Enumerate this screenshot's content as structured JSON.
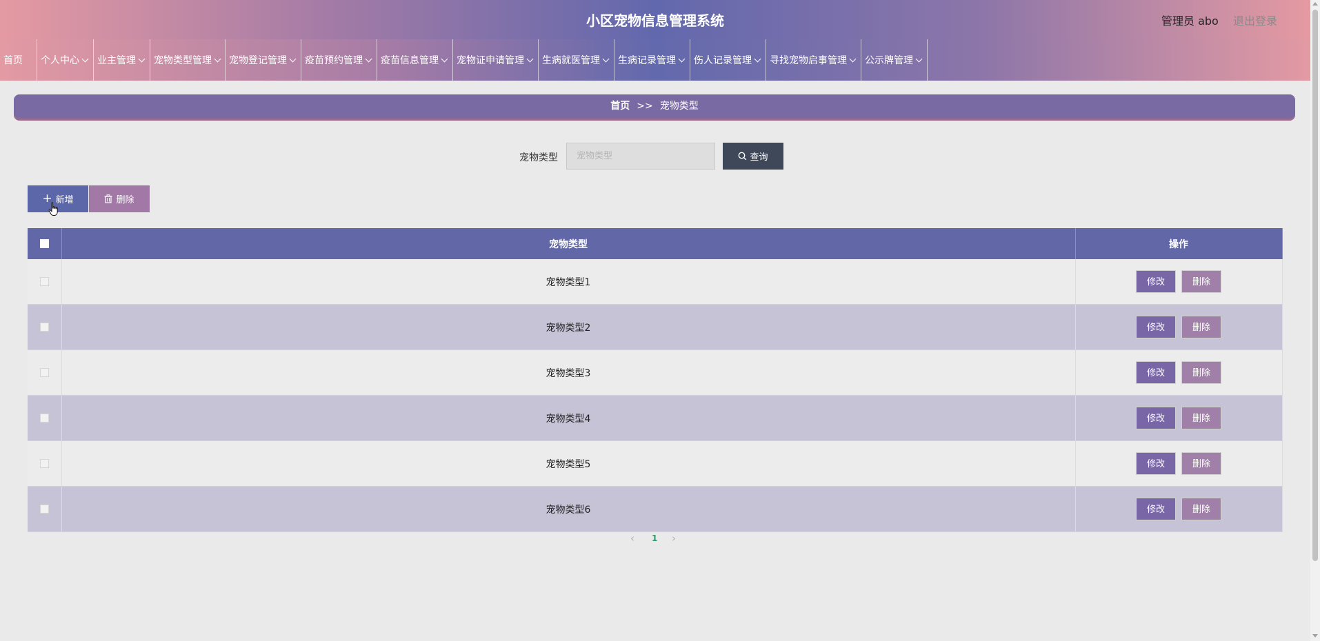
{
  "header": {
    "title": "小区宠物信息管理系统",
    "user_label": "管理员 abo",
    "logout_label": "退出登录"
  },
  "nav": {
    "items": [
      {
        "label": "首页",
        "dropdown": false
      },
      {
        "label": "个人中心",
        "dropdown": true
      },
      {
        "label": "业主管理",
        "dropdown": true
      },
      {
        "label": "宠物类型管理",
        "dropdown": true
      },
      {
        "label": "宠物登记管理",
        "dropdown": true
      },
      {
        "label": "疫苗预约管理",
        "dropdown": true
      },
      {
        "label": "疫苗信息管理",
        "dropdown": true
      },
      {
        "label": "宠物证申请管理",
        "dropdown": true
      },
      {
        "label": "生病就医管理",
        "dropdown": true
      },
      {
        "label": "生病记录管理",
        "dropdown": true
      },
      {
        "label": "伤人记录管理",
        "dropdown": true
      },
      {
        "label": "寻找宠物启事管理",
        "dropdown": true
      },
      {
        "label": "公示牌管理",
        "dropdown": true
      }
    ]
  },
  "breadcrumb": {
    "home": "首页",
    "separator": ">>",
    "current": "宠物类型"
  },
  "search": {
    "label": "宠物类型",
    "placeholder": "宠物类型",
    "value": "",
    "button_label": "查询"
  },
  "toolbar": {
    "add_label": "新增",
    "delete_label": "删除"
  },
  "table": {
    "columns": [
      "",
      "宠物类型",
      "操作"
    ],
    "rows": [
      {
        "pet_type": "宠物类型1",
        "edit_label": "修改",
        "delete_label": "删除"
      },
      {
        "pet_type": "宠物类型2",
        "edit_label": "修改",
        "delete_label": "删除"
      },
      {
        "pet_type": "宠物类型3",
        "edit_label": "修改",
        "delete_label": "删除"
      },
      {
        "pet_type": "宠物类型4",
        "edit_label": "修改",
        "delete_label": "删除"
      },
      {
        "pet_type": "宠物类型5",
        "edit_label": "修改",
        "delete_label": "删除"
      },
      {
        "pet_type": "宠物类型6",
        "edit_label": "修改",
        "delete_label": "删除"
      }
    ]
  },
  "pagination": {
    "current_page": "1"
  },
  "colors": {
    "header_accent": "#6268ad",
    "table_header": "#6267a8",
    "edit_button": "#7866a6",
    "delete_button": "#a07fa8",
    "query_button": "#3e4859"
  }
}
